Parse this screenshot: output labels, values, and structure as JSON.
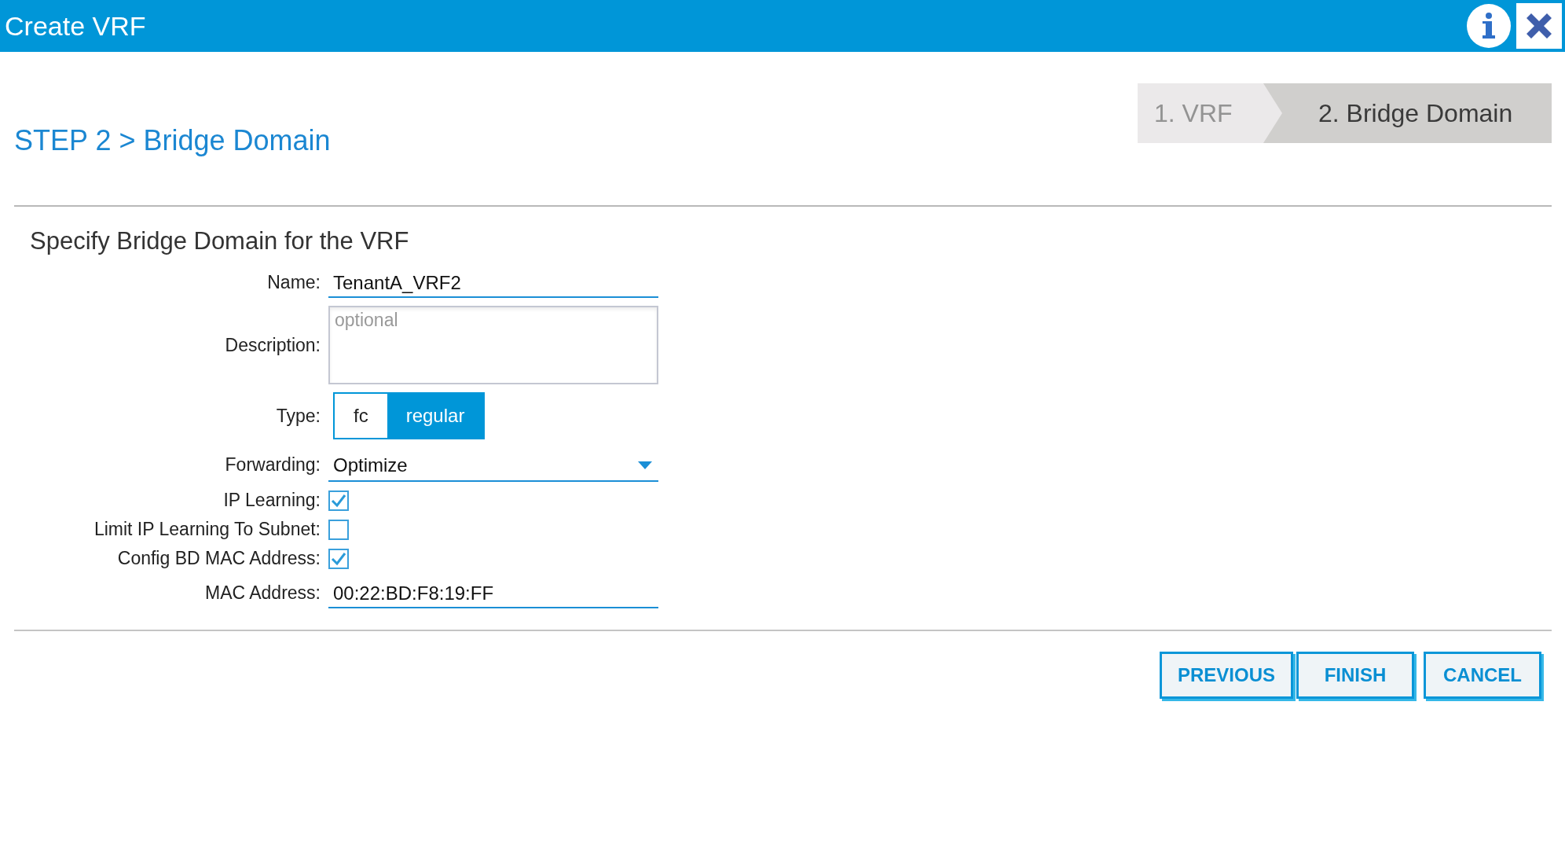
{
  "window": {
    "title": "Create VRF"
  },
  "heading": "STEP 2 > Bridge Domain",
  "steps": [
    {
      "label": "1. VRF",
      "selected": false
    },
    {
      "label": "2. Bridge Domain",
      "selected": true
    }
  ],
  "section_title": "Specify Bridge Domain for the VRF",
  "fields": [
    {
      "kind": "text",
      "label": "Name:",
      "value": "TenantA_VRF2"
    },
    {
      "kind": "textarea",
      "label": "Description:",
      "placeholder": "optional"
    },
    {
      "kind": "segmented",
      "label": "Type:",
      "options": [
        {
          "label": "fc",
          "selected": false
        },
        {
          "label": "regular",
          "selected": true
        }
      ]
    },
    {
      "kind": "dropdown",
      "label": "Forwarding:",
      "value": "Optimize"
    },
    {
      "kind": "checkbox",
      "label": "IP Learning:",
      "checked": true
    },
    {
      "kind": "checkbox",
      "label": "Limit IP Learning To Subnet:",
      "checked": false
    },
    {
      "kind": "checkbox",
      "label": "Config BD MAC Address:",
      "checked": true
    },
    {
      "kind": "text",
      "label": "MAC Address:",
      "value": "00:22:BD:F8:19:FF"
    }
  ],
  "buttons": [
    "PREVIOUS",
    "FINISH",
    "CANCEL"
  ]
}
